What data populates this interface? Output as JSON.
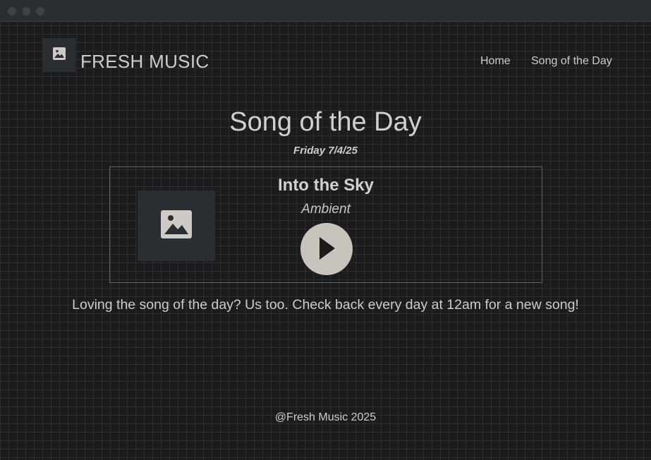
{
  "header": {
    "brand": "FRESH MUSIC",
    "logo_icon": "image-icon",
    "nav": [
      {
        "label": "Home"
      },
      {
        "label": "Song of the Day"
      }
    ]
  },
  "main": {
    "title": "Song of the Day",
    "date": "Friday 7/4/25",
    "song": {
      "title": "Into the Sky",
      "genre": "Ambient",
      "artwork_icon": "image-icon",
      "play_icon": "play-icon"
    },
    "blurb": "Loving the song of the day? Us too. Check back every day at 12am for a new song!"
  },
  "footer": {
    "text": "@Fresh Music 2025"
  },
  "colors": {
    "background": "#1b1c1e",
    "panel": "#2a2d31",
    "text": "#d0cbc6",
    "play_button": "#c9c3be"
  }
}
